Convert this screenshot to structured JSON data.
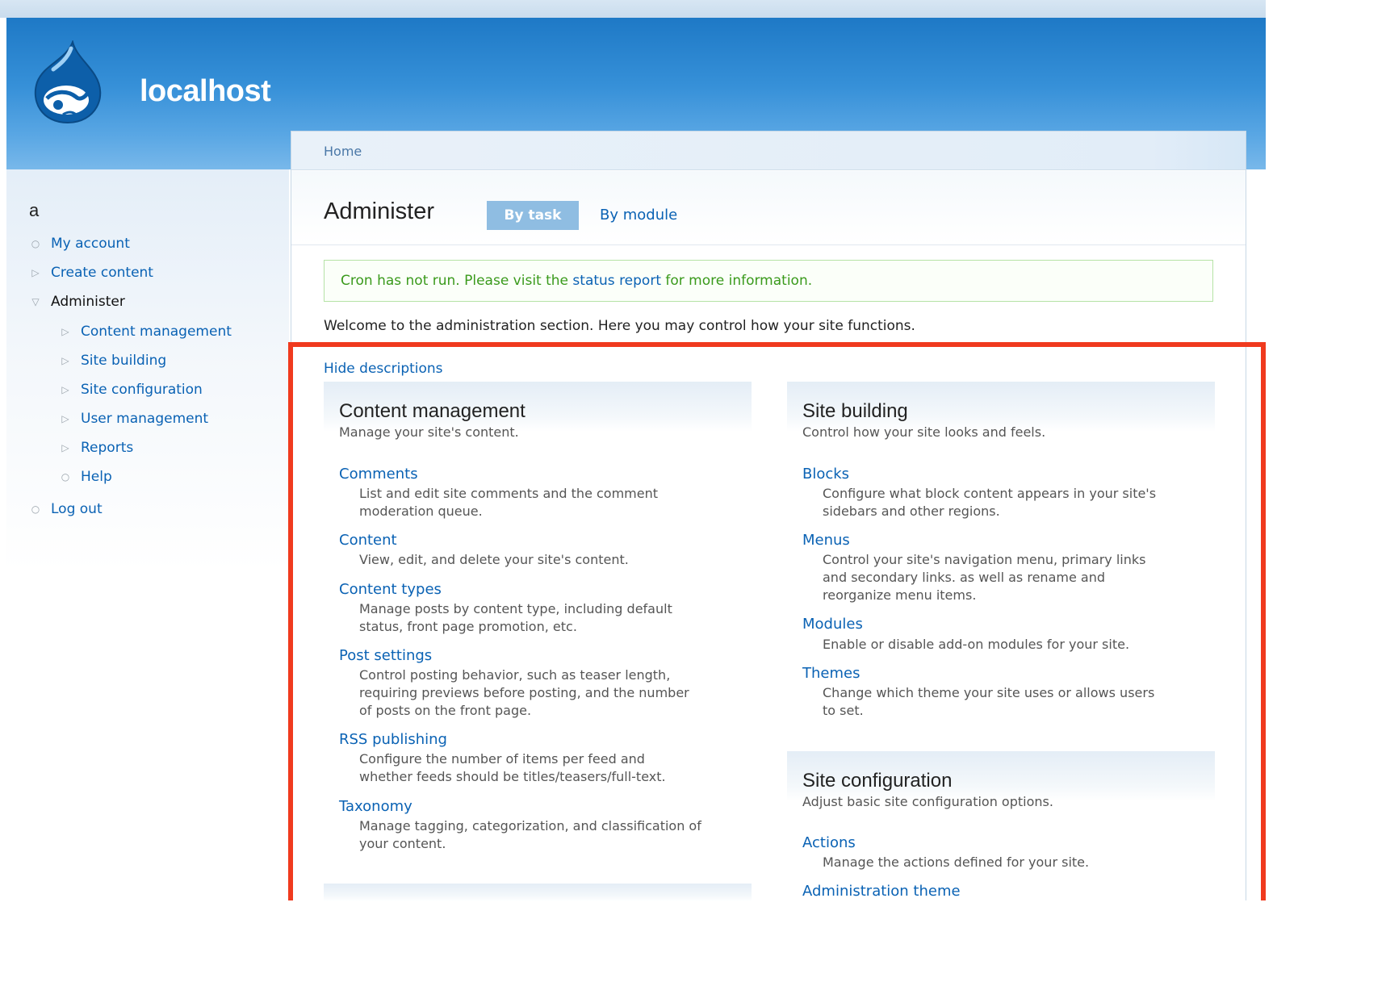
{
  "header": {
    "site_name": "localhost",
    "logo_icon": "drupal-drop-icon"
  },
  "sidebar": {
    "user": "a",
    "items": [
      {
        "label": "My account",
        "bullet": "circle"
      },
      {
        "label": "Create content",
        "bullet": "triangle-right"
      },
      {
        "label": "Administer",
        "bullet": "triangle-down"
      },
      {
        "label": "Content management",
        "bullet": "triangle-right"
      },
      {
        "label": "Site building",
        "bullet": "triangle-right"
      },
      {
        "label": "Site configuration",
        "bullet": "triangle-right"
      },
      {
        "label": "User management",
        "bullet": "triangle-right"
      },
      {
        "label": "Reports",
        "bullet": "triangle-right"
      },
      {
        "label": "Help",
        "bullet": "circle"
      },
      {
        "label": "Log out",
        "bullet": "circle"
      }
    ]
  },
  "breadcrumb": {
    "home": "Home"
  },
  "page": {
    "title": "Administer",
    "tabs": [
      {
        "label": "By task",
        "active": true
      },
      {
        "label": "By module",
        "active": false
      }
    ]
  },
  "messages": {
    "cron_before": "Cron has not run. Please visit the ",
    "cron_link": "status report",
    "cron_after": " for more information."
  },
  "welcome": "Welcome to the administration section. Here you may control how your site functions.",
  "hide_descriptions": "Hide descriptions",
  "sections": {
    "content_management": {
      "title": "Content management",
      "desc": "Manage your site's content.",
      "entries": [
        {
          "link": "Comments",
          "desc": [
            "List and edit site comments and the comment",
            "moderation queue."
          ]
        },
        {
          "link": "Content",
          "desc": [
            "View, edit, and delete your site's content."
          ]
        },
        {
          "link": "Content types",
          "desc": [
            "Manage posts by content type, including default",
            "status, front page promotion, etc."
          ]
        },
        {
          "link": "Post settings",
          "desc": [
            "Control posting behavior, such as teaser length,",
            "requiring previews before posting, and the number",
            "of posts on the front page."
          ]
        },
        {
          "link": "RSS publishing",
          "desc": [
            "Configure the number of items per feed and",
            "whether feeds should be titles/teasers/full-text."
          ]
        },
        {
          "link": "Taxonomy",
          "desc": [
            "Manage tagging, categorization, and classification of",
            "your content."
          ]
        }
      ]
    },
    "site_building": {
      "title": "Site building",
      "desc": "Control how your site looks and feels.",
      "entries": [
        {
          "link": "Blocks",
          "desc": [
            "Configure what block content appears in your site's",
            "sidebars and other regions."
          ]
        },
        {
          "link": "Menus",
          "desc": [
            "Control your site's navigation menu, primary links",
            "and secondary links. as well as rename and",
            "reorganize menu items."
          ]
        },
        {
          "link": "Modules",
          "desc": [
            "Enable or disable add-on modules for your site."
          ]
        },
        {
          "link": "Themes",
          "desc": [
            "Change which theme your site uses or allows users",
            "to set."
          ]
        }
      ]
    },
    "site_configuration": {
      "title": "Site configuration",
      "desc": "Adjust basic site configuration options.",
      "entries": [
        {
          "link": "Actions",
          "desc": [
            "Manage the actions defined for your site."
          ]
        },
        {
          "link": "Administration theme",
          "desc": []
        }
      ]
    }
  },
  "colors": {
    "link": "#0a62b4",
    "highlight": "#f03a1e",
    "status_green": "#3a9a1c",
    "active_tab": "#8fbde2"
  }
}
